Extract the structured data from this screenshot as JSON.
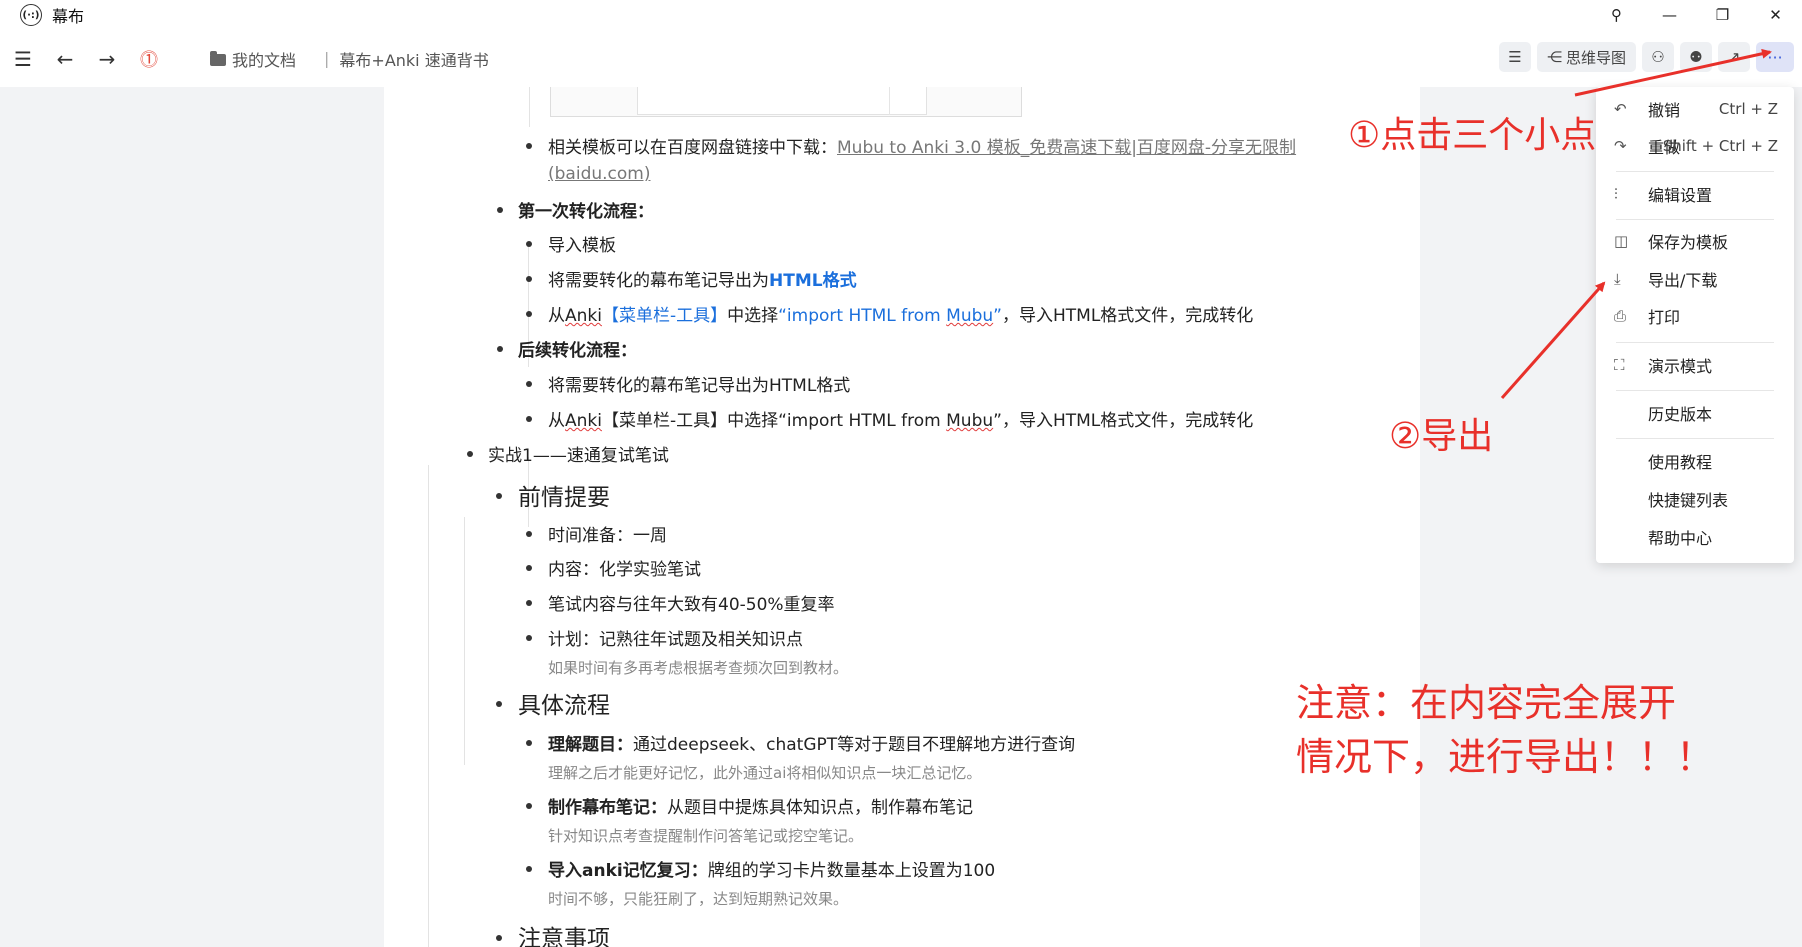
{
  "window": {
    "app_title": "幕布",
    "logo_glyph": "(·:)",
    "controls": {
      "pin": "⚲",
      "minimize": "—",
      "restore": "❐",
      "close": "✕"
    }
  },
  "toolbar": {
    "breadcrumb": {
      "folder": "我的文档",
      "separator": "|",
      "document": "幕布+Anki 速通背书"
    },
    "mindmap_label": "思维导图"
  },
  "document": {
    "items": {
      "template_download_prefix": "相关模板可以在百度网盘链接中下载：",
      "template_link_line1": "Mubu to Anki 3.0 模板_免费高速下载|百度网盘-分享无限制",
      "template_link_line2": "(baidu.com)",
      "first_flow": "第一次转化流程：",
      "import_template": "导入模板",
      "export_html_prefix": "将需要转化的幕布笔记导出为",
      "export_html_bold": "HTML格式",
      "from_anki_1": {
        "a": "从",
        "anki": "Anki",
        "b": "【菜单栏-工具】",
        "c": "中选择",
        "d": "“import HTML from ",
        "mubu": "Mubu",
        "e": "”",
        "f": "，导入HTML格式文件，完成转化"
      },
      "later_flow": "后续转化流程：",
      "export_html_plain": "将需要转化的幕布笔记导出为HTML格式",
      "from_anki_2": {
        "a": "从",
        "anki": "Anki",
        "b": "【菜单栏-工具】中选择“import HTML from ",
        "mubu": "Mubu",
        "c": "”，导入HTML格式文件，完成转化"
      },
      "practice1": "实战1——速通复试笔试",
      "background": "前情提要",
      "time": "时间准备：一周",
      "content": "内容：化学实验笔试",
      "overlap": "笔试内容与往年大致有40-50%重复率",
      "plan": "计划：记熟往年试题及相关知识点",
      "plan_note": "如果时间有多再考虑根据考查频次回到教材。",
      "process": "具体流程",
      "understand_bold": "理解题目：",
      "understand_text": "通过deepseek、chatGPT等对于题目不理解地方进行查询",
      "understand_note": "理解之后才能更好记忆，此外通过ai将相似知识点一块汇总记忆。",
      "make_bold": "制作幕布笔记：",
      "make_text": "从题目中提炼具体知识点，制作幕布笔记",
      "make_note": "针对知识点考查提醒制作问答笔记或挖空笔记。",
      "import_bold": "导入anki记忆复习：",
      "import_text": "牌组的学习卡片数量基本上设置为100",
      "import_note": "时间不够，只能狂刷了，达到短期熟记效果。",
      "attention": "注意事项"
    }
  },
  "menu": {
    "undo": {
      "label": "撤销",
      "shortcut": "Ctrl + Z"
    },
    "redo": {
      "label": "重做",
      "shortcut": "Shift + Ctrl + Z"
    },
    "edit_settings": "编辑设置",
    "save_template": "保存为模板",
    "export": "导出/下载",
    "print": "打印",
    "present": "演示模式",
    "history": "历史版本",
    "tutorial": "使用教程",
    "shortcuts": "快捷键列表",
    "help": "帮助中心"
  },
  "annotations": {
    "step1": "①点击三个小点",
    "step2": "②导出",
    "notice_line1": "注意：在内容完全展开",
    "notice_line2": "情况下，进行导出！！！",
    "color": "#e8302a"
  }
}
